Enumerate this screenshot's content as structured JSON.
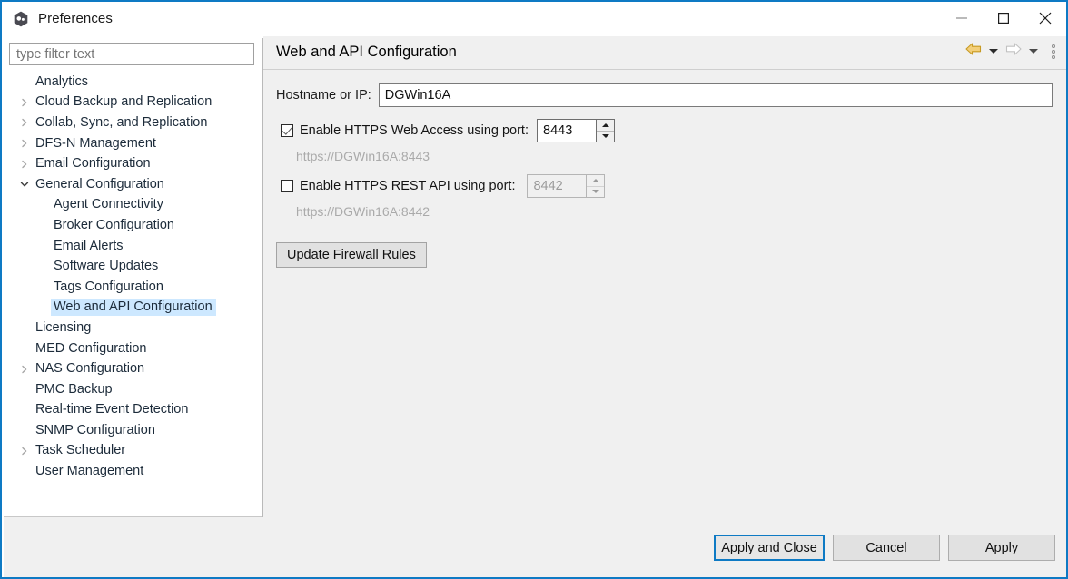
{
  "window": {
    "title": "Preferences",
    "app_icon": "eclipse-hexagon-icon",
    "minimize_label": "—",
    "maximize_label": "□",
    "close_label": "✕",
    "border_color": "#0e7ac4"
  },
  "sidebar": {
    "filter": {
      "value": "",
      "placeholder": "type filter text"
    },
    "items": [
      {
        "label": "Analytics",
        "level": 0,
        "twisty": "none",
        "selected": false
      },
      {
        "label": "Cloud Backup and Replication",
        "level": 0,
        "twisty": "collapsed",
        "selected": false
      },
      {
        "label": "Collab, Sync, and Replication",
        "level": 0,
        "twisty": "collapsed",
        "selected": false
      },
      {
        "label": "DFS-N Management",
        "level": 0,
        "twisty": "collapsed",
        "selected": false
      },
      {
        "label": "Email Configuration",
        "level": 0,
        "twisty": "collapsed",
        "selected": false
      },
      {
        "label": "General Configuration",
        "level": 0,
        "twisty": "expanded",
        "selected": false
      },
      {
        "label": "Agent Connectivity",
        "level": 1,
        "twisty": "none",
        "selected": false
      },
      {
        "label": "Broker Configuration",
        "level": 1,
        "twisty": "none",
        "selected": false
      },
      {
        "label": "Email Alerts",
        "level": 1,
        "twisty": "none",
        "selected": false
      },
      {
        "label": "Software Updates",
        "level": 1,
        "twisty": "none",
        "selected": false
      },
      {
        "label": "Tags Configuration",
        "level": 1,
        "twisty": "none",
        "selected": false
      },
      {
        "label": "Web and API Configuration",
        "level": 1,
        "twisty": "none",
        "selected": true
      },
      {
        "label": "Licensing",
        "level": 0,
        "twisty": "none",
        "selected": false
      },
      {
        "label": "MED Configuration",
        "level": 0,
        "twisty": "none",
        "selected": false
      },
      {
        "label": "NAS Configuration",
        "level": 0,
        "twisty": "collapsed",
        "selected": false
      },
      {
        "label": "PMC Backup",
        "level": 0,
        "twisty": "none",
        "selected": false
      },
      {
        "label": "Real-time Event Detection",
        "level": 0,
        "twisty": "none",
        "selected": false
      },
      {
        "label": "SNMP Configuration",
        "level": 0,
        "twisty": "none",
        "selected": false
      },
      {
        "label": "Task Scheduler",
        "level": 0,
        "twisty": "collapsed",
        "selected": false
      },
      {
        "label": "User Management",
        "level": 0,
        "twisty": "none",
        "selected": false
      }
    ],
    "selection_color": "#cde8ff"
  },
  "content": {
    "title": "Web and API Configuration",
    "nav": {
      "back_icon": "back-arrow-icon",
      "back_enabled": true,
      "forward_icon": "forward-arrow-icon",
      "forward_enabled": false,
      "menu_icon": "kebab-menu-icon",
      "back_color": "#e8b33c",
      "forward_color": "#c9c9c9"
    },
    "form": {
      "hostname": {
        "label": "Hostname or IP:",
        "value": "DGWin16A",
        "placeholder": ""
      },
      "web_access": {
        "label": "Enable HTTPS Web Access using port:",
        "checked": true,
        "port": "8443",
        "enabled": true,
        "url_hint": "https://DGWin16A:8443"
      },
      "rest_api": {
        "label": "Enable HTTPS REST API using port:",
        "checked": false,
        "port": "8442",
        "enabled": false,
        "url_hint": "https://DGWin16A:8442"
      },
      "firewall_button": "Update Firewall Rules"
    }
  },
  "footer": {
    "apply_and_close": "Apply and Close",
    "cancel": "Cancel",
    "apply": "Apply",
    "default_button": "apply_and_close"
  }
}
